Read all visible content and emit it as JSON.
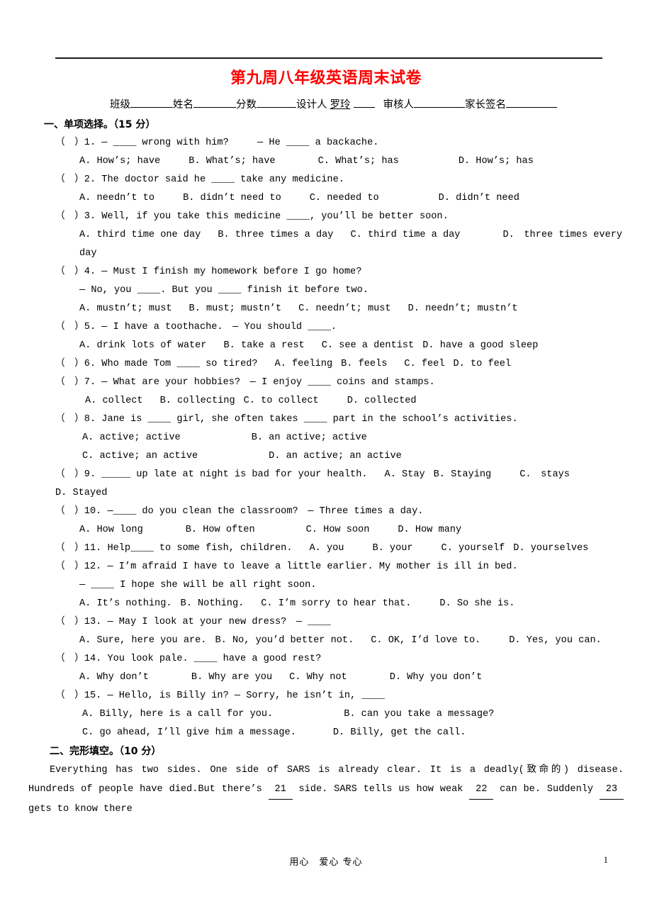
{
  "document": {
    "title": "第九周八年级英语周末试卷",
    "title_color": "#ff0000",
    "info_line": {
      "class_label": "班级",
      "name_label": "姓名",
      "score_label": "分数",
      "designer_label": "设计人",
      "designer_value": "罗玲",
      "reviewer_label": "审核人",
      "parent_sign_label": "家长签名"
    },
    "footer": {
      "motto": "用心　爱心 专心",
      "page_number": "1"
    }
  },
  "sections": [
    {
      "heading": "一、单项选择。（15 分）",
      "questions": [
        {
          "marker": "（　）1.",
          "stem_a": "— ____ wrong with him?",
          "stem_b": "— He ____ a backache.",
          "options": [
            "A. How’s; have",
            "B. What’s; have",
            "C. What’s; has",
            "D. How’s; has"
          ]
        },
        {
          "marker": "（　）2.",
          "stem": "The doctor said he ____ take any medicine.",
          "options": [
            "A. needn’t to",
            "B. didn’t need to",
            "C. needed to",
            "D. didn’t need"
          ]
        },
        {
          "marker": "（　）3.",
          "stem": "Well, if you take this medicine ____, you’ll be better soon.",
          "options": [
            "A. third time one day",
            "B. three times a day",
            "C. third time a day",
            "D.　three times every day"
          ]
        },
        {
          "marker": "（　）4.",
          "stem_a": "— Must I finish my homework before I go home?",
          "stem_b": "— No, you ____. But you ____ finish it before two.",
          "options": [
            "A. mustn’t; must",
            "B. must; mustn’t",
            "C. needn’t; must",
            "D. needn’t; mustn’t"
          ]
        },
        {
          "marker": "（　）5.",
          "stem": "— I have a toothache.　— You should ____.",
          "options": [
            "A. drink lots of water",
            "B. take a rest",
            "C. see a dentist",
            "D. have a good sleep"
          ]
        },
        {
          "marker": "（　）6.",
          "stem": "Who made Tom ____ so tired?",
          "inline_options": [
            "A. feeling",
            "B. feels",
            "C. feel",
            "D. to feel"
          ]
        },
        {
          "marker": "（　）7.",
          "stem": "— What are your hobbies?　— I enjoy ____ coins and stamps.",
          "options": [
            "A. collect",
            "B. collecting",
            "C. to collect",
            "D. collected"
          ]
        },
        {
          "marker": "（　）8.",
          "stem": "Jane is ____ girl, she often takes ____ part in the school’s activities.",
          "options_row1": [
            "A. active; active",
            "B. an active; active"
          ],
          "options_row2": [
            "C. active; an active",
            "D. an active; an active"
          ]
        },
        {
          "marker": "（　）9.",
          "stem": "_____ up late at night is bad for your health.",
          "inline_options": [
            "A. Stay",
            "B. Staying",
            "C.　stays"
          ],
          "wrapped_option": "D. Stayed"
        },
        {
          "marker": "（　）10.",
          "stem": "—____ do you clean the classroom?　— Three times a day.",
          "options": [
            "A. How long",
            "B. How often",
            "C. How soon",
            "D. How many"
          ]
        },
        {
          "marker": "（　）11.",
          "stem": "Help____ to some fish, children.",
          "inline_options": [
            "A. you",
            "B. your",
            "C. yourself",
            "D. yourselves"
          ]
        },
        {
          "marker": "（　）12.",
          "stem_a": "— I’m afraid I have to leave a little earlier. My mother is ill in bed.",
          "stem_b": "— ____ I hope she will be all right soon.",
          "options": [
            "A. It’s nothing.",
            "B. Nothing.",
            "C. I’m sorry to hear that.",
            "D. So she is."
          ]
        },
        {
          "marker": "（　）13.",
          "stem": "— May I look at your new dress?　— ____",
          "options": [
            "A. Sure, here you are.",
            "B. No, you’d better not.",
            "C. OK, I’d love to.",
            "D. Yes, you can."
          ]
        },
        {
          "marker": "（　）14.",
          "stem": "You look pale. ____ have a good rest?",
          "options": [
            "A. Why don’t",
            "B. Why are you",
            "C. Why not",
            "D. Why you don’t"
          ]
        },
        {
          "marker": "（　）15.",
          "stem": "— Hello, is Billy in? — Sorry, he isn’t in, ____",
          "options_row1": [
            "A. Billy, here is a call for you.",
            "B. can you take a message?"
          ],
          "options_row2": [
            "C. go ahead, I’ll give him a message.",
            "D. Billy, get the call."
          ]
        }
      ]
    },
    {
      "heading": "二、完形填空。（10 分）",
      "cloze_passage": {
        "part1": "Everything has two sides. One side of SARS is already clear. It is a deadly(致命的) disease. Hundreds of people have died.But there’s",
        "blank1": "21",
        "part2": "side. SARS tells us how weak",
        "blank2": "22",
        "part3": "can be. Suddenly",
        "blank3": "23",
        "part4": "gets to know there"
      }
    }
  ]
}
